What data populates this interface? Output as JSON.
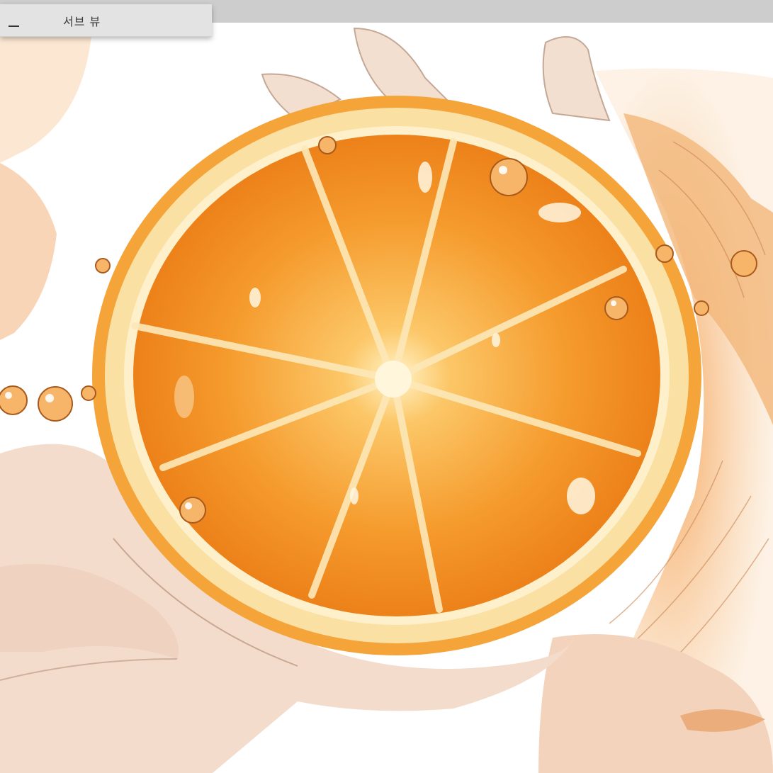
{
  "subview": {
    "title": "서브 뷰",
    "minimize_icon": "minimize-icon"
  },
  "colors": {
    "toolbar": "#cdcdcd",
    "panel": "#e3e3e3",
    "orange_flesh": "#f08a1c",
    "orange_rind": "#fbd99b",
    "skin": "#f2d8c6",
    "hair": "#f0a860"
  }
}
